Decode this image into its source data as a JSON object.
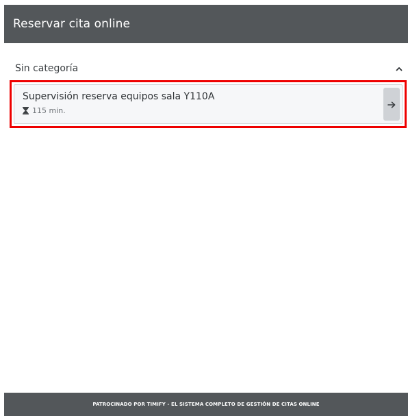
{
  "header": {
    "title": "Reservar cita online"
  },
  "category": {
    "label": "Sin categoría",
    "toggle_icon": "chevron-up-icon"
  },
  "services": [
    {
      "name": "Supervisión reserva equipos sala Y110A",
      "duration": "115 min.",
      "duration_icon": "hourglass-icon",
      "action_icon": "arrow-right-icon"
    }
  ],
  "footer": {
    "text": "PATROCINADO POR TIMIFY - EL SISTEMA COMPLETO DE GESTIÓN DE CITAS ONLINE"
  },
  "colors": {
    "header_bg": "#53575a",
    "footer_bg": "#53575a",
    "card_bg": "#f6f7f9",
    "highlight_border": "#ee0000",
    "arrow_button_bg": "#cfd2d6"
  }
}
